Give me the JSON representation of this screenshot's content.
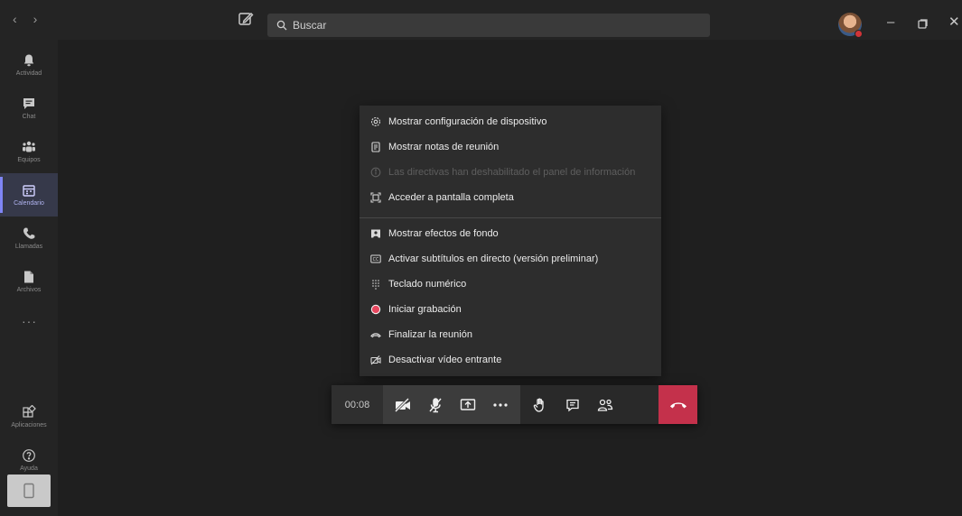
{
  "titlebar": {
    "search_placeholder": "Buscar"
  },
  "rail": {
    "items": [
      {
        "label": "Actividad",
        "icon": "bell-icon"
      },
      {
        "label": "Chat",
        "icon": "chat-icon"
      },
      {
        "label": "Equipos",
        "icon": "teams-icon"
      },
      {
        "label": "Calendario",
        "icon": "calendar-icon",
        "active": true
      },
      {
        "label": "Llamadas",
        "icon": "phone-icon"
      },
      {
        "label": "Archivos",
        "icon": "files-icon"
      }
    ],
    "more": "···",
    "bottom_items": [
      {
        "label": "Aplicaciones",
        "icon": "apps-icon"
      },
      {
        "label": "Ayuda",
        "icon": "help-icon"
      }
    ]
  },
  "menu": {
    "items": [
      {
        "label": "Mostrar configuración de dispositivo",
        "icon": "gear-icon"
      },
      {
        "label": "Mostrar notas de reunión",
        "icon": "notes-icon"
      },
      {
        "label": "Las directivas han deshabilitado el panel de información",
        "icon": "info-icon",
        "disabled": true
      },
      {
        "label": "Acceder a pantalla completa",
        "icon": "fullscreen-icon"
      },
      {
        "label": "Mostrar efectos de fondo",
        "icon": "background-effects-icon"
      },
      {
        "label": "Activar subtítulos en directo (versión preliminar)",
        "icon": "captions-icon"
      },
      {
        "label": "Teclado numérico",
        "icon": "keypad-icon"
      },
      {
        "label": "Iniciar grabación",
        "icon": "record-icon"
      },
      {
        "label": "Finalizar la reunión",
        "icon": "end-meeting-icon"
      },
      {
        "label": "Desactivar vídeo entrante",
        "icon": "video-off-icon"
      }
    ]
  },
  "callbar": {
    "timer": "00:08"
  },
  "colors": {
    "hangup": "#c4314b",
    "record": "#e8475f",
    "accent": "#7f85f5"
  }
}
